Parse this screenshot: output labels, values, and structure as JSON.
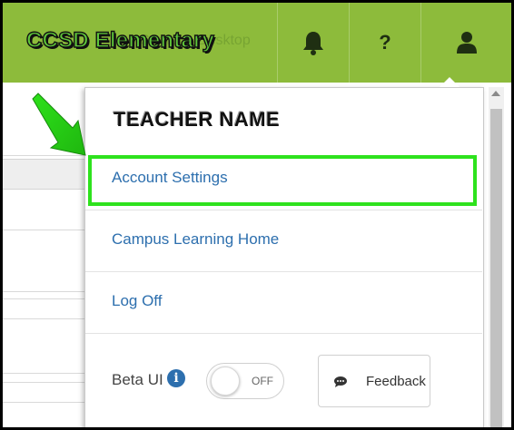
{
  "header": {
    "school_name": "CCSD Elementary",
    "obscured_title": "Campus Desktop"
  },
  "menu": {
    "teacher_name": "TEACHER NAME",
    "items": [
      {
        "label": "Account Settings"
      },
      {
        "label": "Campus Learning Home"
      },
      {
        "label": "Log Off"
      }
    ],
    "beta_label": "Beta UI",
    "toggle_state": "OFF",
    "feedback_label": "Feedback"
  },
  "colors": {
    "header_green": "#8dbb3b",
    "link_blue": "#2d6fae",
    "highlight_green": "#2ee21d"
  }
}
